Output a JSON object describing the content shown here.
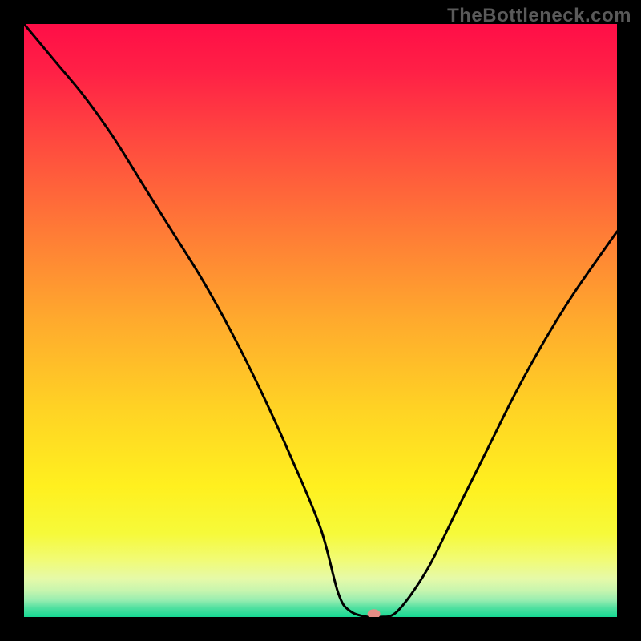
{
  "watermark": "TheBottleneck.com",
  "chart_data": {
    "type": "line",
    "title": "",
    "xlabel": "",
    "ylabel": "",
    "xlim": [
      0,
      100
    ],
    "ylim": [
      0,
      100
    ],
    "series": [
      {
        "name": "bottleneck-curve",
        "x": [
          0,
          5,
          10,
          15,
          20,
          25,
          30,
          35,
          40,
          45,
          50,
          53,
          55,
          58,
          60,
          63,
          68,
          73,
          78,
          83,
          88,
          93,
          100
        ],
        "y": [
          100,
          94,
          88,
          81,
          73,
          65,
          57,
          48,
          38,
          27,
          15,
          4,
          1,
          0,
          0,
          1,
          8,
          18,
          28,
          38,
          47,
          55,
          65
        ]
      }
    ],
    "marker": {
      "x": 59,
      "y": 0.5,
      "color": "#e58e86",
      "rx": 8,
      "ry": 6
    },
    "gradient_stops": [
      {
        "offset": 0,
        "color": "#ff0e47"
      },
      {
        "offset": 0.08,
        "color": "#ff2046"
      },
      {
        "offset": 0.2,
        "color": "#ff4a3f"
      },
      {
        "offset": 0.35,
        "color": "#ff7b36"
      },
      {
        "offset": 0.5,
        "color": "#ffaa2d"
      },
      {
        "offset": 0.65,
        "color": "#ffd324"
      },
      {
        "offset": 0.78,
        "color": "#fff01f"
      },
      {
        "offset": 0.86,
        "color": "#f6fa3a"
      },
      {
        "offset": 0.905,
        "color": "#f1fb77"
      },
      {
        "offset": 0.935,
        "color": "#e6faa8"
      },
      {
        "offset": 0.955,
        "color": "#c8f5ae"
      },
      {
        "offset": 0.972,
        "color": "#96edb0"
      },
      {
        "offset": 0.985,
        "color": "#4fe0a0"
      },
      {
        "offset": 1.0,
        "color": "#17d993"
      }
    ],
    "curve_color": "#000000",
    "curve_width": 3
  }
}
